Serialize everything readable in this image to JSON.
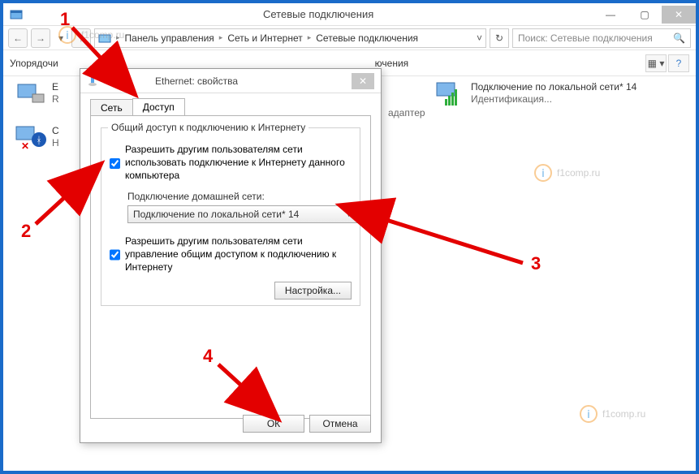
{
  "window": {
    "title": "Сетевые подключения",
    "breadcrumb": {
      "items": [
        "Панель управления",
        "Сеть и Интернет",
        "Сетевые подключения"
      ]
    },
    "search_placeholder": "Поиск: Сетевые подключения",
    "toolbar": {
      "organize": "Упорядочи",
      "toolright": "ючения"
    }
  },
  "adapters": {
    "a1": {
      "name": "E",
      "line2": "R"
    },
    "a2": {
      "name": "С",
      "line2": "Н"
    },
    "a3": {
      "name": "адаптер"
    },
    "a4": {
      "name": "Подключение по локальной сети* 14",
      "line2": "Идентификация..."
    }
  },
  "dialog": {
    "title": "Ethernet: свойства",
    "tabs": {
      "network": "Сеть",
      "sharing": "Доступ"
    },
    "group_legend": "Общий доступ к подключению к Интернету",
    "allow_label": "Разрешить другим пользователям сети использовать подключение к Интернету данного компьютера",
    "home_label": "Подключение домашней сети:",
    "combo_value": "Подключение по локальной сети* 14",
    "allow_control": "Разрешить другим пользователям сети управление общим доступом к подключению к Интернету",
    "settings_btn": "Настройка...",
    "ok": "ОК",
    "cancel": "Отмена"
  },
  "watermark": "f1comp.ru",
  "annotations": {
    "n1": "1",
    "n2": "2",
    "n3": "3",
    "n4": "4"
  }
}
